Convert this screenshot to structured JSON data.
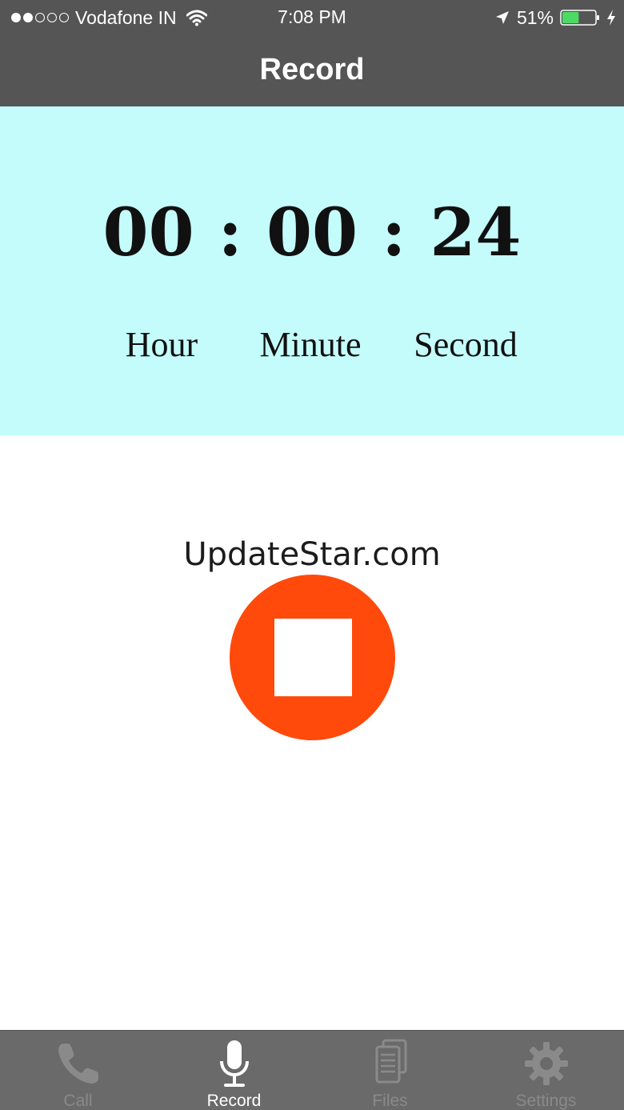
{
  "status_bar": {
    "carrier": "Vodafone IN",
    "time": "7:08 PM",
    "battery": "51%",
    "signal_bars_filled": 2,
    "signal_bars_total": 5,
    "battery_level": 0.51,
    "battery_color": "#4cd964"
  },
  "nav": {
    "title": "Record"
  },
  "timer": {
    "hours": "00",
    "minutes": "00",
    "seconds": "24",
    "separator": ":",
    "labels": {
      "hour": "Hour",
      "minute": "Minute",
      "second": "Second"
    },
    "panel_color": "#c4fbfb"
  },
  "watermark": "UpdateStar.com",
  "stop_button": {
    "icon": "stop-icon",
    "color": "#ff4a0c"
  },
  "tabs": [
    {
      "label": "Call",
      "icon": "phone-icon",
      "active": false
    },
    {
      "label": "Record",
      "icon": "microphone-icon",
      "active": true
    },
    {
      "label": "Files",
      "icon": "files-icon",
      "active": false
    },
    {
      "label": "Settings",
      "icon": "gear-icon",
      "active": false
    }
  ]
}
